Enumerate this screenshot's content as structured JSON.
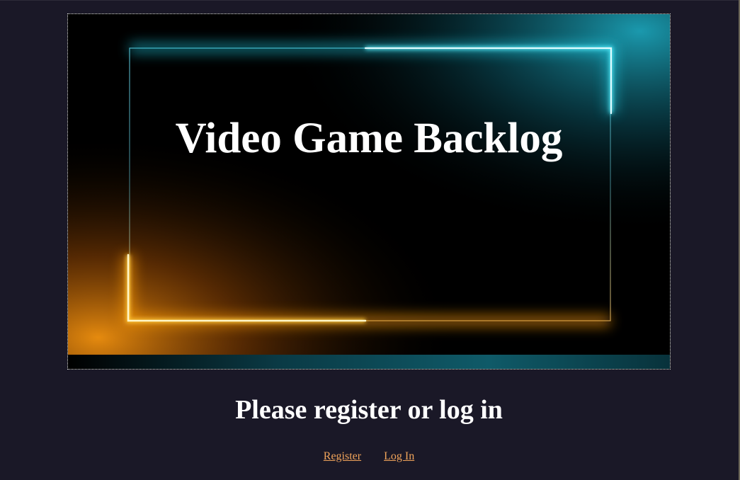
{
  "banner": {
    "title": "Video Game Backlog"
  },
  "main": {
    "heading": "Please register or log in",
    "links": {
      "register": "Register",
      "login": "Log In"
    }
  },
  "colors": {
    "page_background": "#1a1827",
    "cyan_glow": "#3fe8ff",
    "orange_glow": "#ffb020",
    "link": "#f0a35a",
    "text": "#ffffff"
  }
}
